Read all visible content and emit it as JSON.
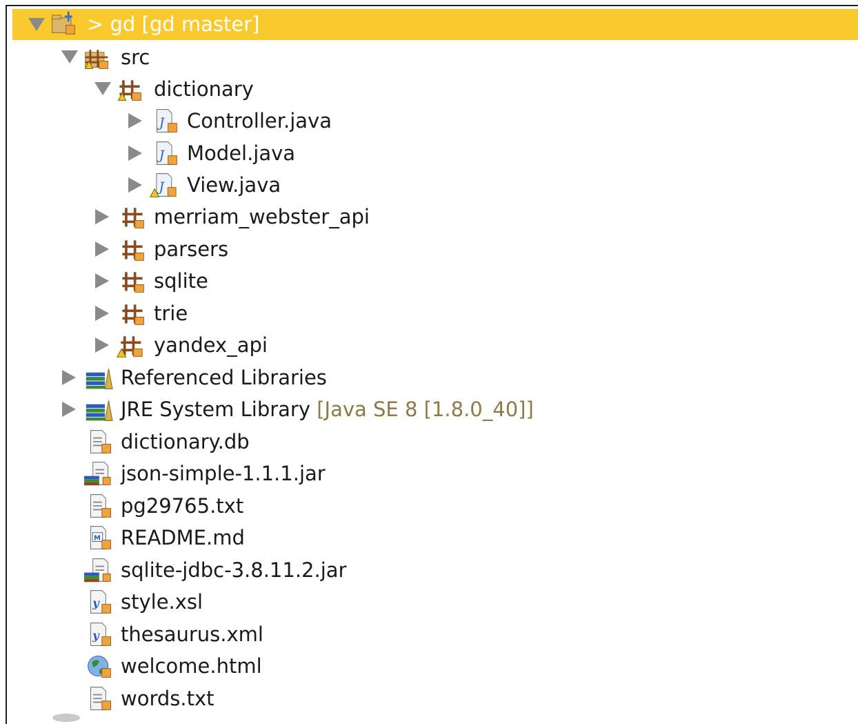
{
  "tree": {
    "project": {
      "label": "> gd  [gd master]"
    },
    "src": {
      "label": "src"
    },
    "dictionary_pkg": {
      "label": "dictionary"
    },
    "controller": {
      "label": "Controller.java"
    },
    "model": {
      "label": "Model.java"
    },
    "view": {
      "label": "View.java"
    },
    "merriam": {
      "label": "merriam_webster_api"
    },
    "parsers": {
      "label": "parsers"
    },
    "sqlite": {
      "label": "sqlite"
    },
    "trie": {
      "label": "trie"
    },
    "yandex": {
      "label": "yandex_api"
    },
    "ref_libs": {
      "label": "Referenced Libraries"
    },
    "jre": {
      "label": "JRE System Library",
      "decoration": "[Java SE 8 [1.8.0_40]]"
    },
    "dictionary_db": {
      "label": "dictionary.db"
    },
    "json_jar": {
      "label": "json-simple-1.1.1.jar"
    },
    "pg_txt": {
      "label": "pg29765.txt"
    },
    "readme": {
      "label": "README.md"
    },
    "sqlite_jar": {
      "label": "sqlite-jdbc-3.8.11.2.jar"
    },
    "style_xsl": {
      "label": "style.xsl"
    },
    "thesaurus": {
      "label": "thesaurus.xml"
    },
    "welcome": {
      "label": "welcome.html"
    },
    "words": {
      "label": "words.txt"
    }
  },
  "colors": {
    "selection": "#f9c92d",
    "decoration": "#8f7a45",
    "arrow": "#8a8a8a"
  },
  "icons": {
    "project": "git-project-icon",
    "source_folder": "source-folder-icon",
    "package": "package-icon",
    "java_file": "java-file-icon",
    "library": "library-icon",
    "file": "text-file-icon",
    "jar": "jar-file-icon",
    "markdown": "markdown-file-icon",
    "xml": "xml-file-icon",
    "html": "html-file-icon"
  }
}
